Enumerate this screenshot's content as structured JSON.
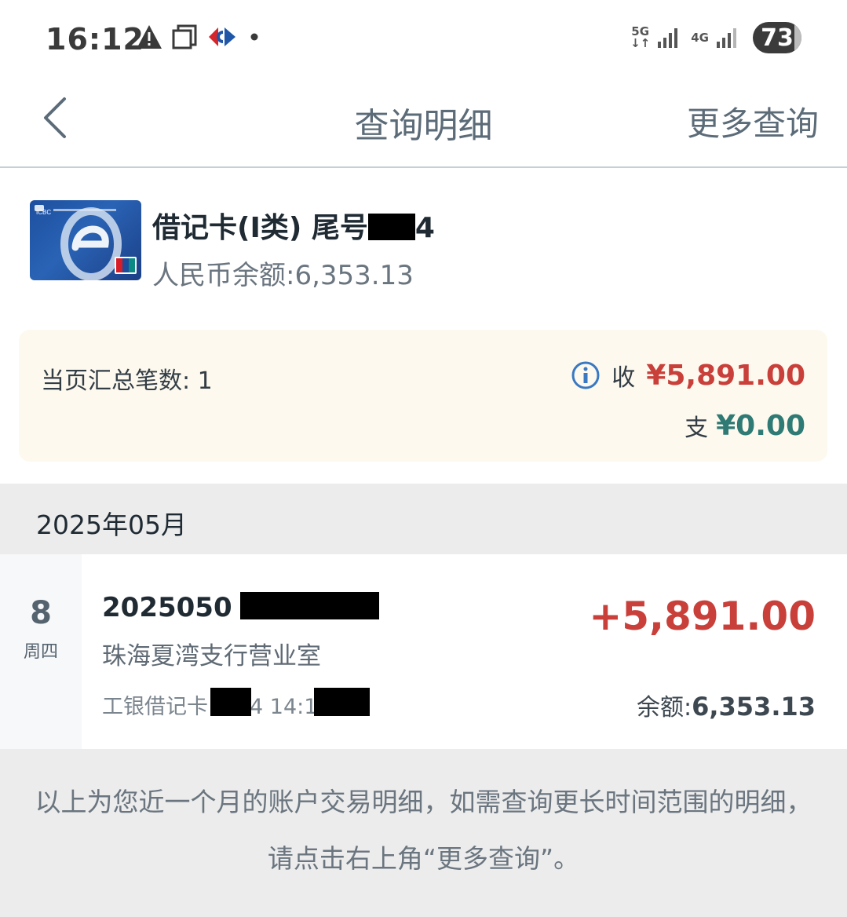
{
  "status_bar": {
    "time": "16:12",
    "network_1": "5G",
    "network_2": "4G",
    "battery": "73"
  },
  "nav": {
    "title": "查询明细",
    "more_query": "更多查询"
  },
  "account": {
    "card_title_prefix": "借记卡(I类)  尾号",
    "card_title_suffix": "4",
    "balance_label": "人民币余额:6,353.13",
    "card_brand": "ICBC"
  },
  "summary": {
    "count_label": "当页汇总笔数: 1",
    "income_label": "收",
    "income_amount": "¥5,891.00",
    "expense_label": "支",
    "expense_amount": "¥0.00"
  },
  "month": "2025年05月",
  "transactions": [
    {
      "day": "8",
      "weekday": "周四",
      "id": "2025050",
      "branch": "珠海夏湾支行营业室",
      "meta_prefix": "工银借记卡",
      "meta_mid": "4  14:1",
      "amount": "+5,891.00",
      "balance_label": "余额:",
      "balance_value": "6,353.13"
    }
  ],
  "footer_note": "以上为您近一个月的账户交易明细，如需查询更长时间范围的明细，请点击右上角“更多查询”。",
  "colors": {
    "income": "#c9403b",
    "expense": "#2f7a74",
    "summary_bg": "#fdf9ee"
  }
}
